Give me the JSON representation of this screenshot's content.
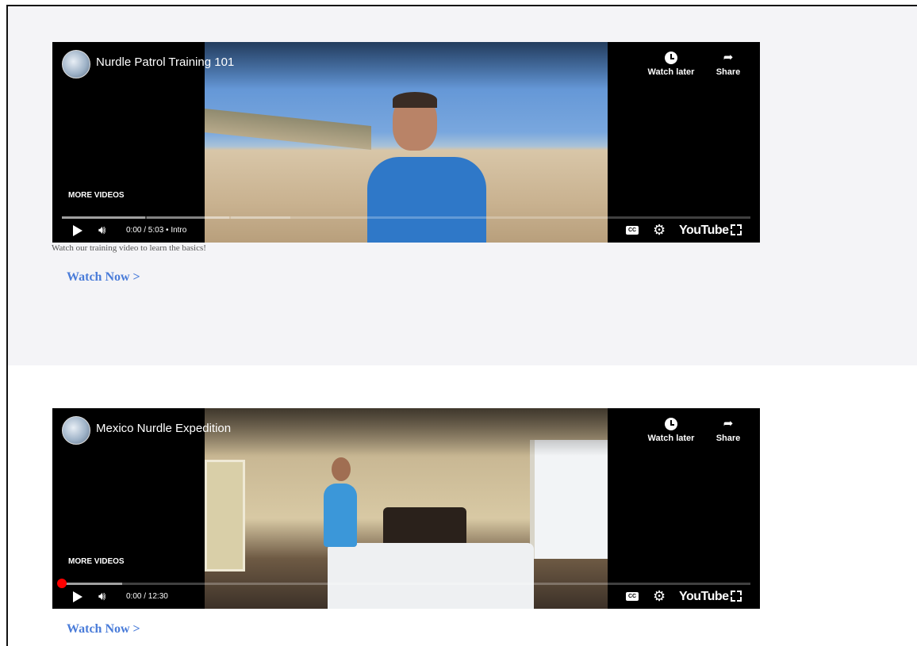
{
  "videos": [
    {
      "title": "Nurdle Patrol Training 101",
      "watch_later": "Watch later",
      "share": "Share",
      "more_videos": "MORE VIDEOS",
      "time": "0:00 / 5:03 • Intro",
      "cc": "CC",
      "youtube": "YouTube",
      "caption": "Watch our training video to learn the basics!",
      "watch_now": "Watch Now >"
    },
    {
      "title": "Mexico Nurdle Expedition",
      "watch_later": "Watch later",
      "share": "Share",
      "more_videos": "MORE VIDEOS",
      "time": "0:00 / 12:30",
      "cc": "CC",
      "youtube": "YouTube",
      "watch_now": "Watch Now >"
    }
  ],
  "colors": {
    "link": "#4a7cd9",
    "scrub": "#ff0000",
    "section_bg": "#f4f4f7"
  }
}
